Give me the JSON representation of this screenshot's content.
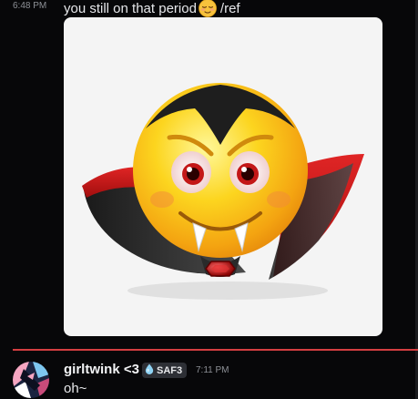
{
  "messages": [
    {
      "timestamp": "6:48 PM",
      "text_before": "you still on that period",
      "emoji": "relieved-face-emoji",
      "text_after": "/ref",
      "attachment": {
        "type": "image",
        "subject": "vampire-emoji-image"
      }
    },
    {
      "author": "girltwink <3",
      "tag": {
        "icon": "droplet-icon",
        "label": "SAF3"
      },
      "timestamp": "7:11 PM",
      "text": "oh~"
    }
  ],
  "colors": {
    "background": "#070709",
    "new_message_divider": "#d33e41",
    "timestamp": "#8d9096",
    "text": "#e6e7ea"
  }
}
